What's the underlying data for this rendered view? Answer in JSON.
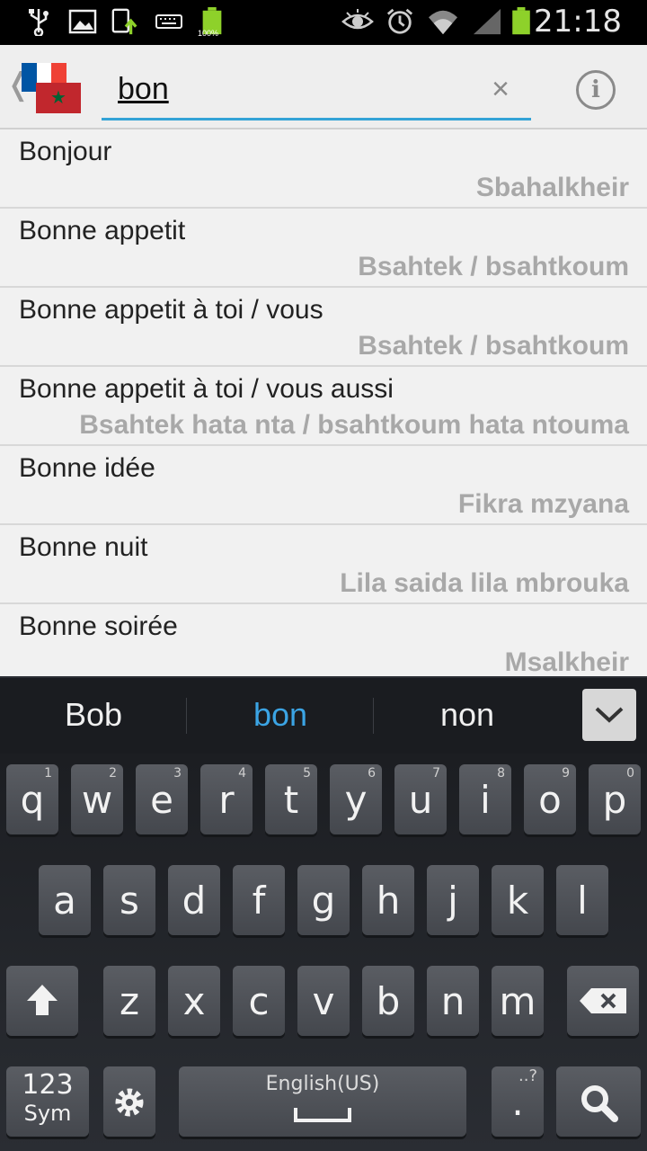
{
  "status_bar": {
    "time": "21:18",
    "battery_percent": "100%",
    "icons": [
      "usb-icon",
      "image-icon",
      "download-icon",
      "keyboard-icon",
      "battery-icon",
      "eye-icon",
      "alarm-icon",
      "wifi-icon",
      "signal-icon"
    ]
  },
  "action_bar": {
    "search_value": "bon",
    "back_glyph": "❬",
    "clear_glyph": "×",
    "info_glyph": "i",
    "morocco_star": "★",
    "colors": {
      "accent": "#33a3d6",
      "france_blue": "#0055a4",
      "france_red": "#ef4135",
      "morocco_red": "#c1272d",
      "morocco_green": "#006233"
    }
  },
  "results": [
    {
      "fr": "Bonjour",
      "ma": "Sbahalkheir"
    },
    {
      "fr": "Bonne appetit",
      "ma": "Bsahtek / bsahtkoum"
    },
    {
      "fr": "Bonne appetit à toi / vous",
      "ma": "Bsahtek / bsahtkoum"
    },
    {
      "fr": "Bonne appetit à toi / vous aussi",
      "ma": "Bsahtek hata nta / bsahtkoum hata ntouma"
    },
    {
      "fr": "Bonne idée",
      "ma": "Fikra mzyana"
    },
    {
      "fr": "Bonne nuit",
      "ma": "Lila saida lila mbrouka"
    },
    {
      "fr": "Bonne soirée",
      "ma": "Msalkheir"
    }
  ],
  "suggestions": {
    "items": [
      "Bob",
      "bon",
      "non"
    ],
    "toggle_glyph": "⌄"
  },
  "keyboard": {
    "row1": [
      {
        "k": "q",
        "n": "1"
      },
      {
        "k": "w",
        "n": "2"
      },
      {
        "k": "e",
        "n": "3"
      },
      {
        "k": "r",
        "n": "4"
      },
      {
        "k": "t",
        "n": "5"
      },
      {
        "k": "y",
        "n": "6"
      },
      {
        "k": "u",
        "n": "7"
      },
      {
        "k": "i",
        "n": "8"
      },
      {
        "k": "o",
        "n": "9"
      },
      {
        "k": "p",
        "n": "0"
      }
    ],
    "row2": [
      "a",
      "s",
      "d",
      "f",
      "g",
      "h",
      "j",
      "k",
      "l"
    ],
    "row3": [
      "z",
      "x",
      "c",
      "v",
      "b",
      "n",
      "m"
    ],
    "shift_glyph": "⬆",
    "backspace_glyph": "⌫",
    "sym_label_1": "123",
    "sym_label_2": "Sym",
    "settings_glyph": "⚙",
    "space_label": "English(US)",
    "period_label": ".",
    "period_hint": "..?",
    "search_glyph": "⚲"
  }
}
